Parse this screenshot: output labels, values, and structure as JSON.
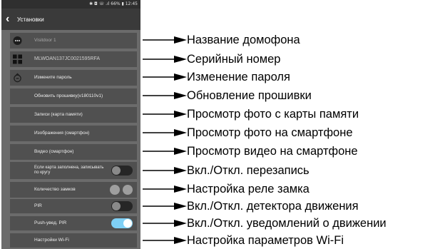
{
  "status_bar": {
    "text": "✱ ◘ ☏ .ıl 66% ▮ 12:45"
  },
  "app_bar": {
    "title": "Установки"
  },
  "settings": {
    "intercom_name": "Visitdoor 1",
    "serial_number": "MLWOAN137JC0021595RFA",
    "change_password": "Измените пароль",
    "update_firmware": "Обновить прошивку(v180110v1)",
    "records_card": "Записи (карта памяти)",
    "images_phone": "Изображения (смартфон)",
    "video_phone": "Видео (смартфон)",
    "overwrite_label": "Если карта заполнена, записывать по кругу",
    "overwrite_on": false,
    "lock_count_label": "Количество замков",
    "pir_label": "PIR",
    "pir_on": false,
    "push_pir_label": "Push-увед. PIR",
    "push_pir_on": true,
    "wifi_settings": "Настройки Wi-Fi"
  },
  "annotations": [
    "Название домофона",
    "Серийный номер",
    "Изменение пароля",
    "Обновление прошивки",
    "Просмотр фото с карты памяти",
    "Просмотр фото на смартфоне",
    "Просмотр видео на смартфоне",
    "Вкл./Откл. перезапись",
    "Настройка реле замка",
    "Вкл./Откл. детектора движения",
    "Вкл./Откл. уведомлений о движении",
    "Настройка параметров Wi-Fi"
  ]
}
